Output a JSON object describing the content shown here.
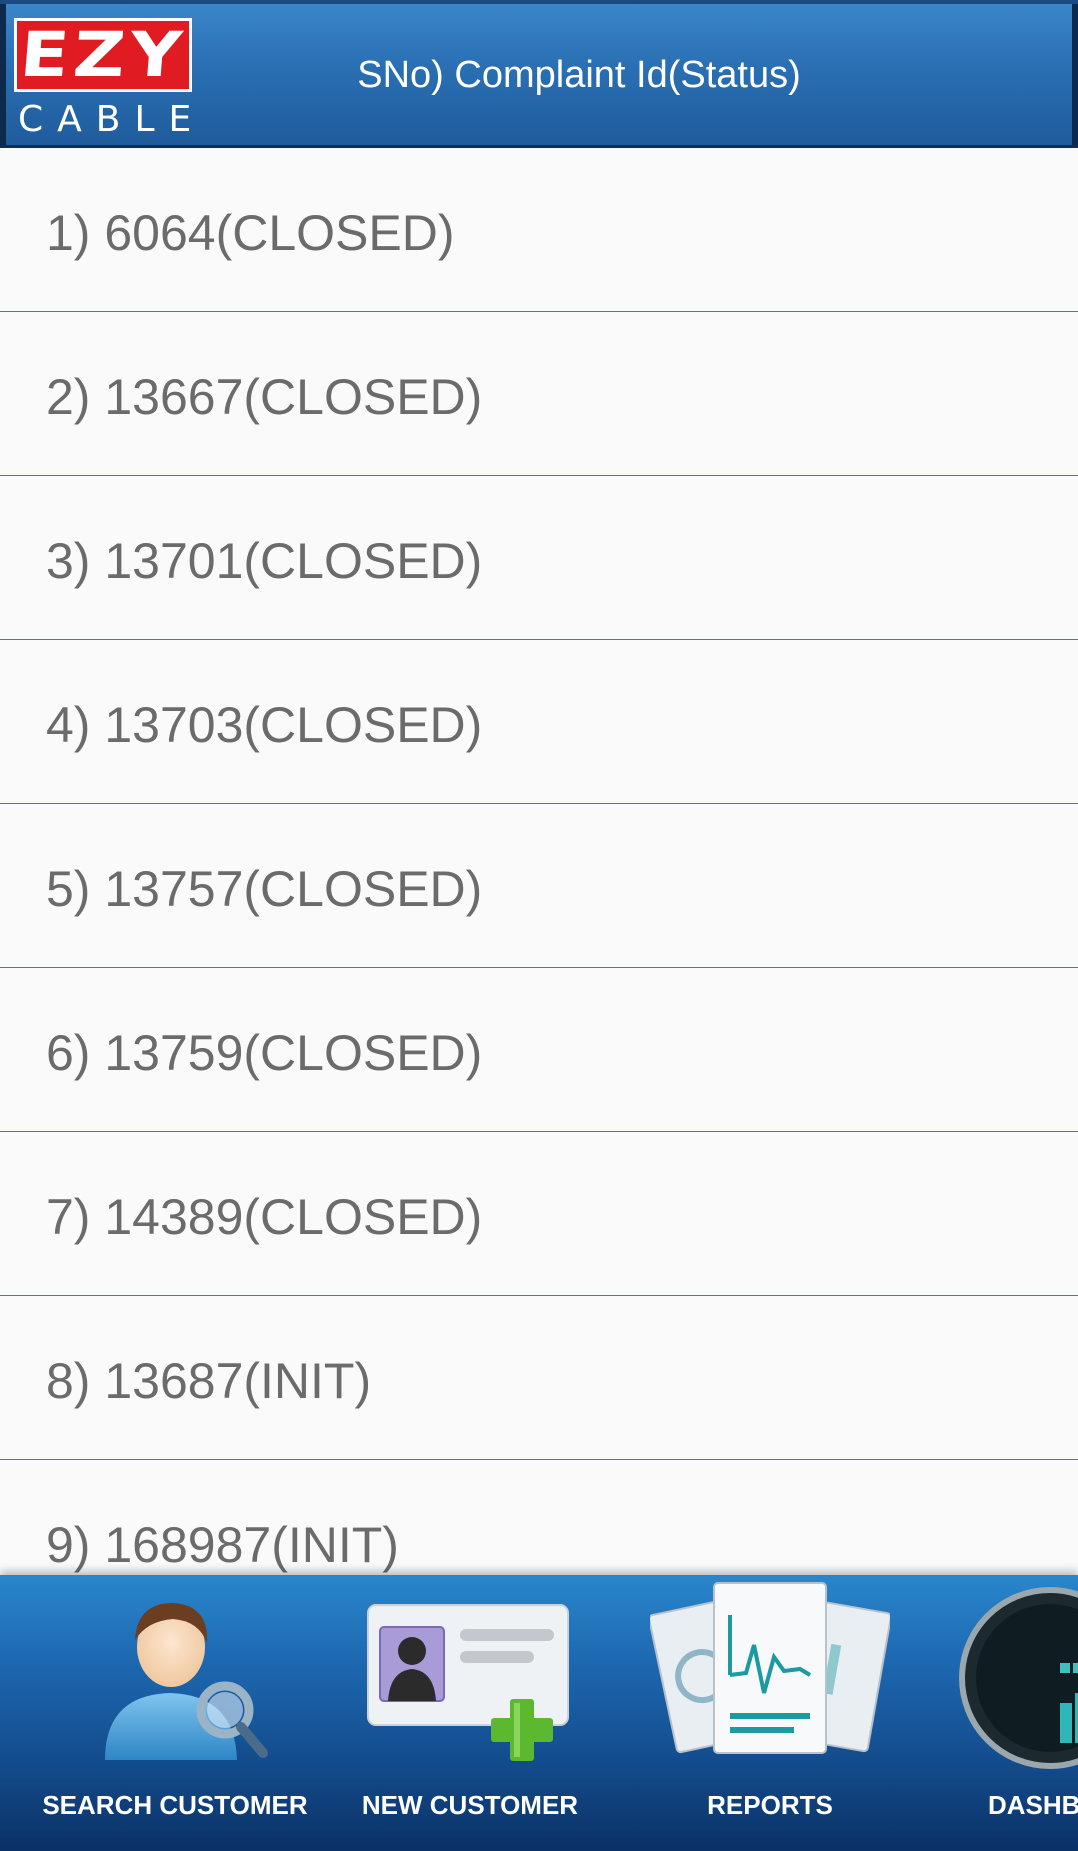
{
  "header": {
    "logo_top": "EZY",
    "logo_bottom": "CABLE",
    "title": "SNo) Complaint Id(Status)"
  },
  "complaints": [
    {
      "label": "1) 6064(CLOSED)"
    },
    {
      "label": "2) 13667(CLOSED)"
    },
    {
      "label": "3) 13701(CLOSED)"
    },
    {
      "label": "4) 13703(CLOSED)"
    },
    {
      "label": "5) 13757(CLOSED)"
    },
    {
      "label": "6) 13759(CLOSED)"
    },
    {
      "label": "7) 14389(CLOSED)"
    },
    {
      "label": "8) 13687(INIT)"
    },
    {
      "label": "9) 168987(INIT)"
    }
  ],
  "bottom_nav": {
    "items": [
      {
        "label": "SEARCH CUSTOMER",
        "icon": "search-customer-icon"
      },
      {
        "label": "NEW CUSTOMER",
        "icon": "new-customer-icon"
      },
      {
        "label": "REPORTS",
        "icon": "reports-icon"
      },
      {
        "label": "DASHB",
        "icon": "dashboard-icon"
      }
    ]
  },
  "colors": {
    "header_blue": "#2a6fb3",
    "logo_red": "#e11b22",
    "divider_teal": "#2a8aa6",
    "list_text": "#6b6b6b"
  }
}
